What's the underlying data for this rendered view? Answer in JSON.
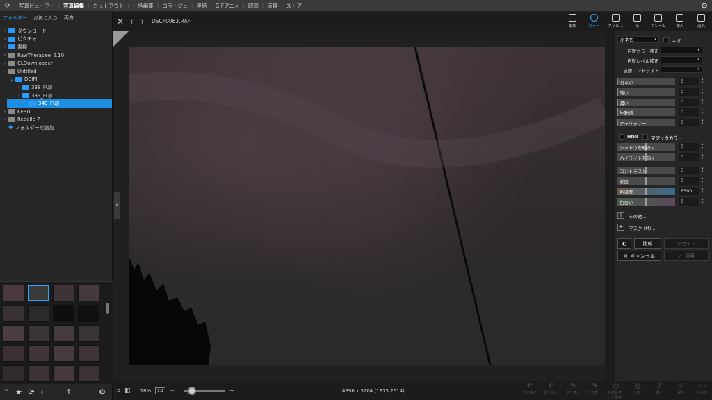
{
  "menu": {
    "items": [
      "写真ビューアー",
      "写真編集",
      "カットアウト",
      "一括編集",
      "コラージュ",
      "連結",
      "GIFアニメ",
      "印刷",
      "道具",
      "ストア"
    ],
    "active_index": 1
  },
  "left_panel": {
    "tabs": [
      "フォルダー",
      "お気に入り",
      "両方"
    ],
    "active_tab": 0,
    "tree": [
      {
        "label": "ダウンロード",
        "indent": 0,
        "arrow": "›",
        "icon": "folder-blue"
      },
      {
        "label": "ピクチャ",
        "indent": 0,
        "arrow": "›",
        "icon": "folder-blue"
      },
      {
        "label": "書類",
        "indent": 0,
        "arrow": "›",
        "icon": "folder-blue"
      },
      {
        "label": "RawTherapee_5.10",
        "indent": 0,
        "arrow": "›",
        "icon": "folder-grey"
      },
      {
        "label": "CLDownloader",
        "indent": 0,
        "arrow": "›",
        "icon": "folder-grey"
      },
      {
        "label": "Untitled",
        "indent": 0,
        "arrow": "⌄",
        "icon": "folder-grey"
      },
      {
        "label": "DCIM",
        "indent": 1,
        "arrow": "⌄",
        "icon": "folder-blue"
      },
      {
        "label": "338_FUJI",
        "indent": 2,
        "arrow": "›",
        "icon": "folder-blue"
      },
      {
        "label": "339_FUJI",
        "indent": 2,
        "arrow": "›",
        "icon": "folder-blue"
      },
      {
        "label": "340_FUJI",
        "indent": 2,
        "arrow": "",
        "icon": "folder-blue",
        "selected": true
      },
      {
        "label": "KESU",
        "indent": 0,
        "arrow": "›",
        "icon": "folder-grey"
      },
      {
        "label": "Rebelle 7",
        "indent": 0,
        "arrow": "›",
        "icon": "folder-grey"
      },
      {
        "label": "フォルダーを追加",
        "indent": 0,
        "arrow": "",
        "icon": "plus"
      }
    ]
  },
  "viewer": {
    "filename": "DSCF0063.RAF",
    "zoom": "28%",
    "zoom_1to1": "1:1",
    "zoom_slider_fraction": 0.2,
    "dimensions": "4896 x 3264 (1375,2614)"
  },
  "tools": [
    {
      "label": "編集",
      "icon": "edit-icon"
    },
    {
      "label": "カラー",
      "icon": "color-icon",
      "active": true
    },
    {
      "label": "フィル...",
      "icon": "filter-icon"
    },
    {
      "label": "光",
      "icon": "light-icon"
    },
    {
      "label": "フレーム",
      "icon": "frame-icon"
    },
    {
      "label": "挿入",
      "icon": "insert-icon"
    },
    {
      "label": "道具",
      "icon": "tools-icon"
    }
  ],
  "bottom_actions": [
    "元に戻す",
    "取り消し",
    "やり直し",
    "やり直し",
    "名前を付けて保存",
    "比較",
    "開く",
    "保存",
    "その他"
  ],
  "color_panel": {
    "preset": "原本色",
    "negative_label": "ネガ",
    "auto_rows": [
      "自動カラー補正",
      "自動レベル補正",
      "自動コントラスト"
    ],
    "sliders_a": [
      {
        "name": "明るい",
        "value": "0"
      },
      {
        "name": "暗い",
        "value": "0"
      },
      {
        "name": "濃い",
        "value": "0"
      },
      {
        "name": "生動感",
        "value": "0"
      },
      {
        "name": "クラリティー",
        "value": "0"
      }
    ],
    "hdr_label": "HDR",
    "magic_label": "マジックカラー",
    "sliders_b": [
      {
        "name": "シャドウを明るく",
        "value": "0"
      },
      {
        "name": "ハイライトを暗く",
        "value": "0"
      }
    ],
    "sliders_c": [
      {
        "name": "コントラスト",
        "value": "0"
      },
      {
        "name": "彩度",
        "value": "0"
      },
      {
        "name": "色温度",
        "value": "6500"
      },
      {
        "name": "色合い",
        "value": "0"
      }
    ],
    "more_label": "その他...",
    "mask_label": "マスク (M)...",
    "compare_label": "比較",
    "reset_label": "リセット",
    "cancel_label": "キャンセル",
    "apply_label": "適用"
  }
}
